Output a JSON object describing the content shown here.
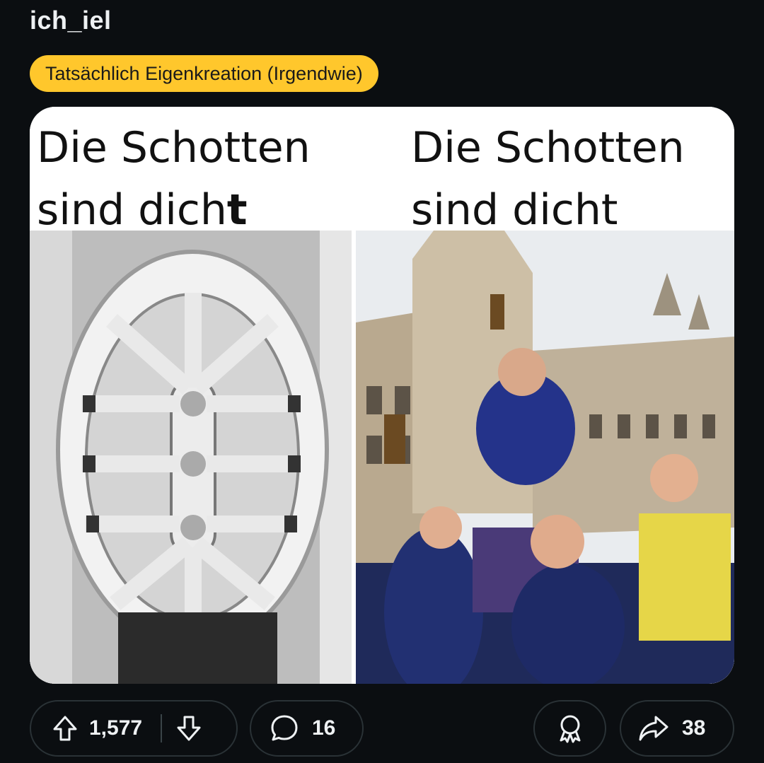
{
  "post": {
    "subreddit": "ich_iel",
    "flair": "Tatsächlich Eigenkreation (Irgendwie)"
  },
  "meme": {
    "left": {
      "caption_line1": "Die Schotten",
      "caption_line2_prefix": "sind dich",
      "caption_line2_bold": "t"
    },
    "right": {
      "caption_line1": "Die Schotten",
      "caption_line2": "sind dicht"
    }
  },
  "actions": {
    "upvotes": "1,577",
    "comments": "16",
    "shares": "38"
  },
  "colors": {
    "background": "#0b0e11",
    "flair_bg": "#ffc72c",
    "pill_border": "#2a3236"
  },
  "icons": [
    "upvote-arrow-icon",
    "downvote-arrow-icon",
    "comment-bubble-icon",
    "award-ribbon-icon",
    "share-arrow-icon"
  ]
}
